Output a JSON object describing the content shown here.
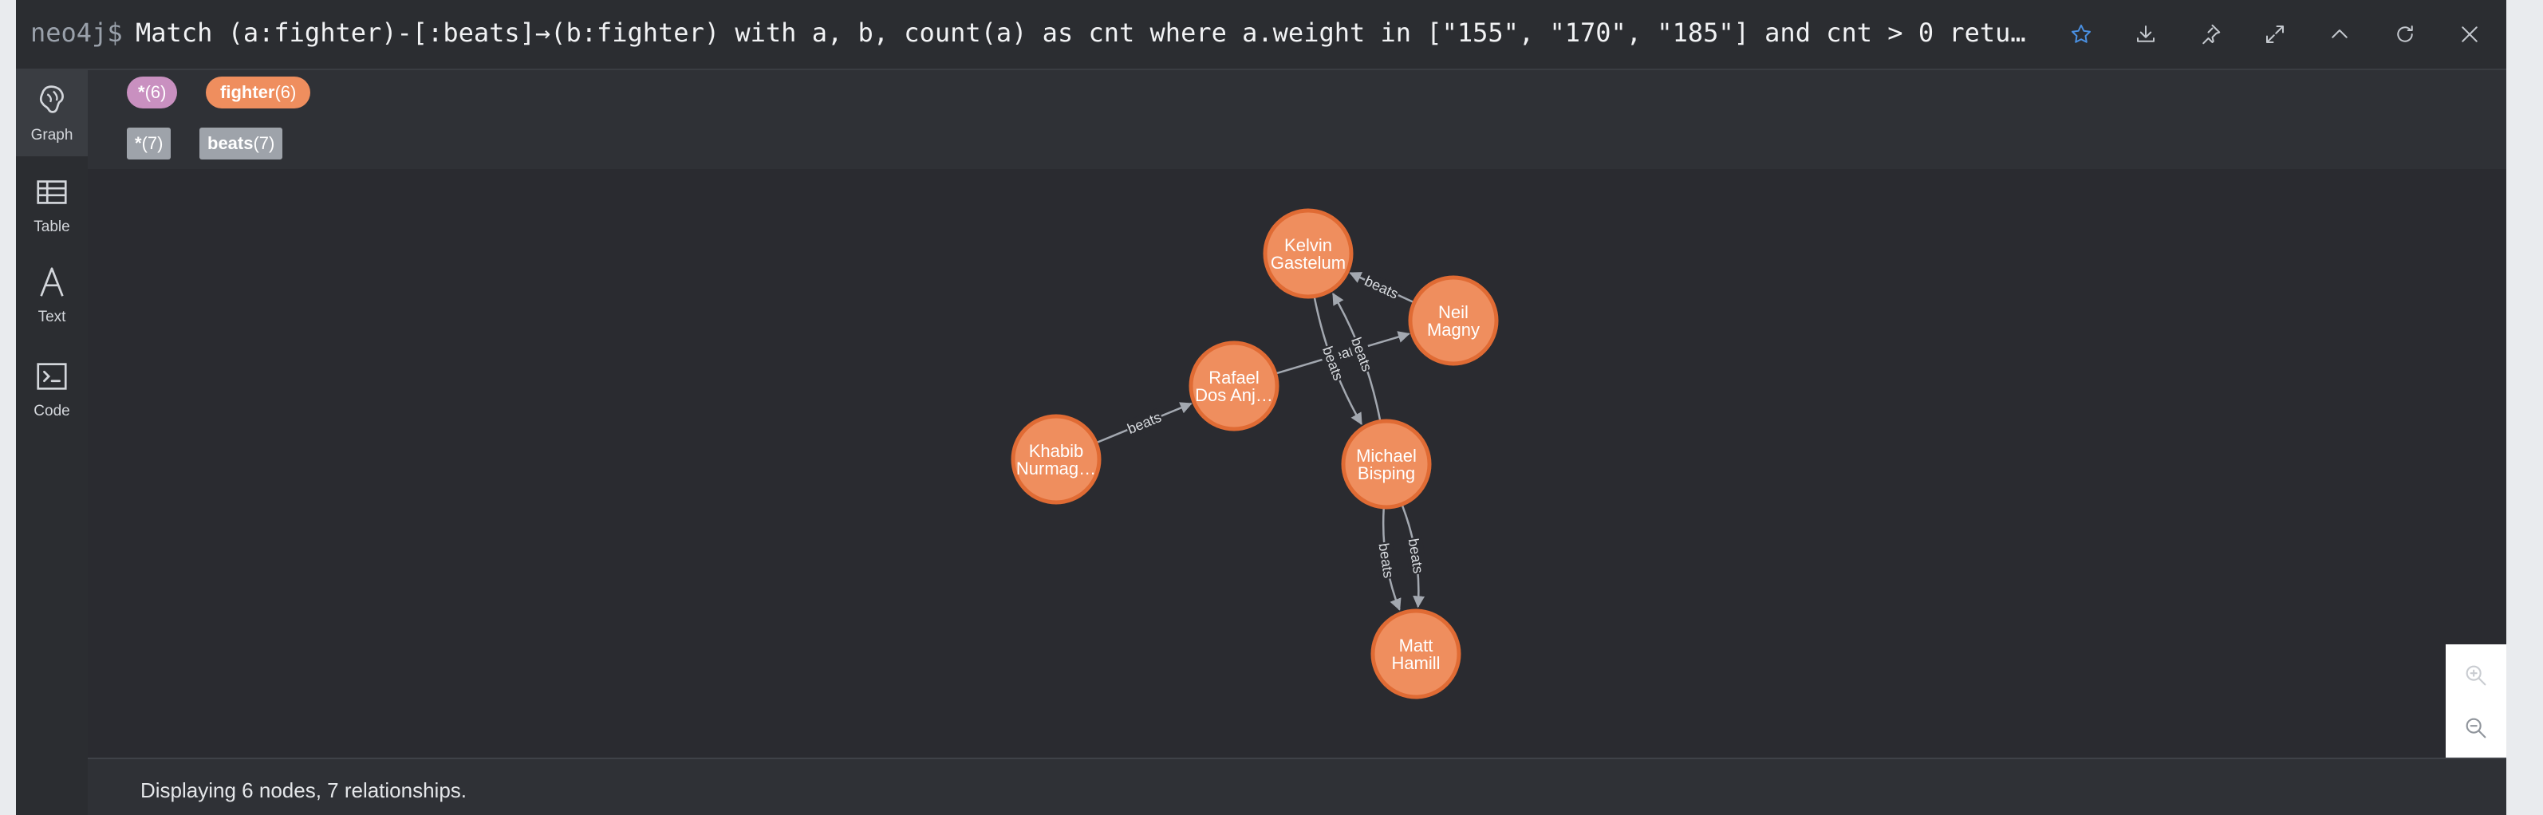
{
  "query_bar": {
    "prompt": "neo4j$",
    "query": "Match (a:fighter)-[:beats]→(b:fighter) with a, b, count(a) as cnt where a.weight in [\"155\", \"170\", \"185\"] and cnt > 0 retu…",
    "buttons": [
      "star-icon",
      "download-icon",
      "pin-icon",
      "expand-icon",
      "collapse-icon",
      "refresh-icon",
      "close-icon"
    ]
  },
  "sidebar": {
    "items": [
      {
        "label": "Graph",
        "icon": "graph-icon",
        "active": true
      },
      {
        "label": "Table",
        "icon": "table-icon",
        "active": false
      },
      {
        "label": "Text",
        "icon": "text-icon",
        "active": false
      },
      {
        "label": "Code",
        "icon": "code-icon",
        "active": false
      }
    ]
  },
  "legend": {
    "node_labels": [
      {
        "name": "*",
        "count": "(6)",
        "color": "#c990c0"
      },
      {
        "name": "fighter",
        "count": "(6)",
        "color": "#ef8e5e"
      }
    ],
    "relationship_types": [
      {
        "name": "*",
        "count": "(7)"
      },
      {
        "name": "beats",
        "count": "(7)"
      }
    ]
  },
  "graph": {
    "nodes": [
      {
        "id": "kelvin",
        "lines": [
          "Kelvin",
          "Gastelum"
        ]
      },
      {
        "id": "neil",
        "lines": [
          "Neil",
          "Magny"
        ]
      },
      {
        "id": "rafael",
        "lines": [
          "Rafael",
          "Dos Anj…"
        ]
      },
      {
        "id": "khabib",
        "lines": [
          "Khabib",
          "Nurmag…"
        ]
      },
      {
        "id": "michael",
        "lines": [
          "Michael",
          "Bisping"
        ]
      },
      {
        "id": "matt",
        "lines": [
          "Matt",
          "Hamill"
        ]
      }
    ],
    "relationships": [
      {
        "from": "khabib",
        "to": "rafael",
        "label": "beats"
      },
      {
        "from": "rafael",
        "to": "neil",
        "label": "beats"
      },
      {
        "from": "neil",
        "to": "kelvin",
        "label": "beats"
      },
      {
        "from": "kelvin",
        "to": "michael",
        "label": "beats"
      },
      {
        "from": "michael",
        "to": "kelvin",
        "label": "beats"
      },
      {
        "from": "michael",
        "to": "matt",
        "label": "beats"
      },
      {
        "from": "michael",
        "to": "matt",
        "label": "beats"
      }
    ]
  },
  "zoom": {
    "in_icon": "zoom-in-icon",
    "out_icon": "zoom-out-icon"
  },
  "status": {
    "text": "Displaying 6 nodes, 7 relationships."
  },
  "colors": {
    "node_fill": "#ef8e5e",
    "node_stroke": "#e06b34",
    "background": "#2a2b30",
    "relationship": "#a3a8b0"
  }
}
